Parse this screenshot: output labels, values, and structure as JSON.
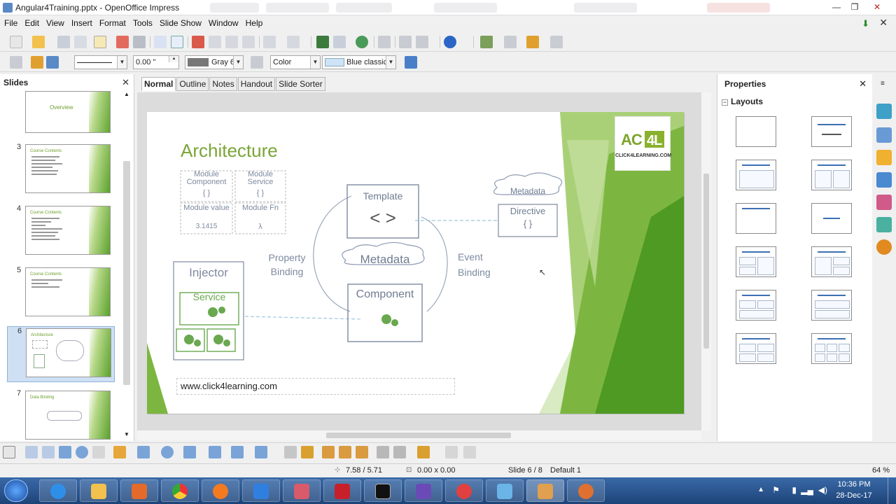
{
  "window": {
    "title": "Angular4Training.pptx - OpenOffice Impress"
  },
  "menu": [
    "File",
    "Edit",
    "View",
    "Insert",
    "Format",
    "Tools",
    "Slide Show",
    "Window",
    "Help"
  ],
  "toolbar2": {
    "line_width": "0.00 \"",
    "line_color": "Gray 6",
    "area_style": "Color",
    "area_fill": "Blue classic"
  },
  "slides_panel": {
    "title": "Slides",
    "thumbs": [
      {
        "num": "",
        "title": "Overview"
      },
      {
        "num": "3",
        "title": "Course Contents"
      },
      {
        "num": "4",
        "title": "Course Contents"
      },
      {
        "num": "5",
        "title": "Course Contents"
      },
      {
        "num": "6",
        "title": "Architecture"
      },
      {
        "num": "7",
        "title": "Data Binding"
      }
    ]
  },
  "view_tabs": [
    "Normal",
    "Outline",
    "Notes",
    "Handout",
    "Slide Sorter"
  ],
  "slide": {
    "title": "Architecture",
    "logo_text": "CLICK4LEARNING.COM",
    "footer_url": "www.click4learning.com",
    "diagram": {
      "module_component": "Module Component",
      "module_service": "Module Service",
      "module_value": "Module value",
      "value_sample": "3.1415",
      "module_fn": "Module Fn",
      "fn_symbol": "λ",
      "braces": "{ }",
      "template": "Template",
      "template_symbol": "< >",
      "metadata_top": "Metadata",
      "directive": "Directive",
      "property_binding": "Property Binding",
      "metadata_mid": "Metadata",
      "event_binding": "Event Binding",
      "injector": "Injector",
      "service": "Service",
      "component": "Component"
    }
  },
  "properties": {
    "title": "Properties",
    "section": "Layouts"
  },
  "status": {
    "position": "7.58 / 5.71",
    "size": "0.00 x 0.00",
    "slide": "Slide 6 / 8",
    "master": "Default 1",
    "zoom": "64 %"
  },
  "taskbar": {
    "time": "10:36 PM",
    "date": "28-Dec-17"
  }
}
